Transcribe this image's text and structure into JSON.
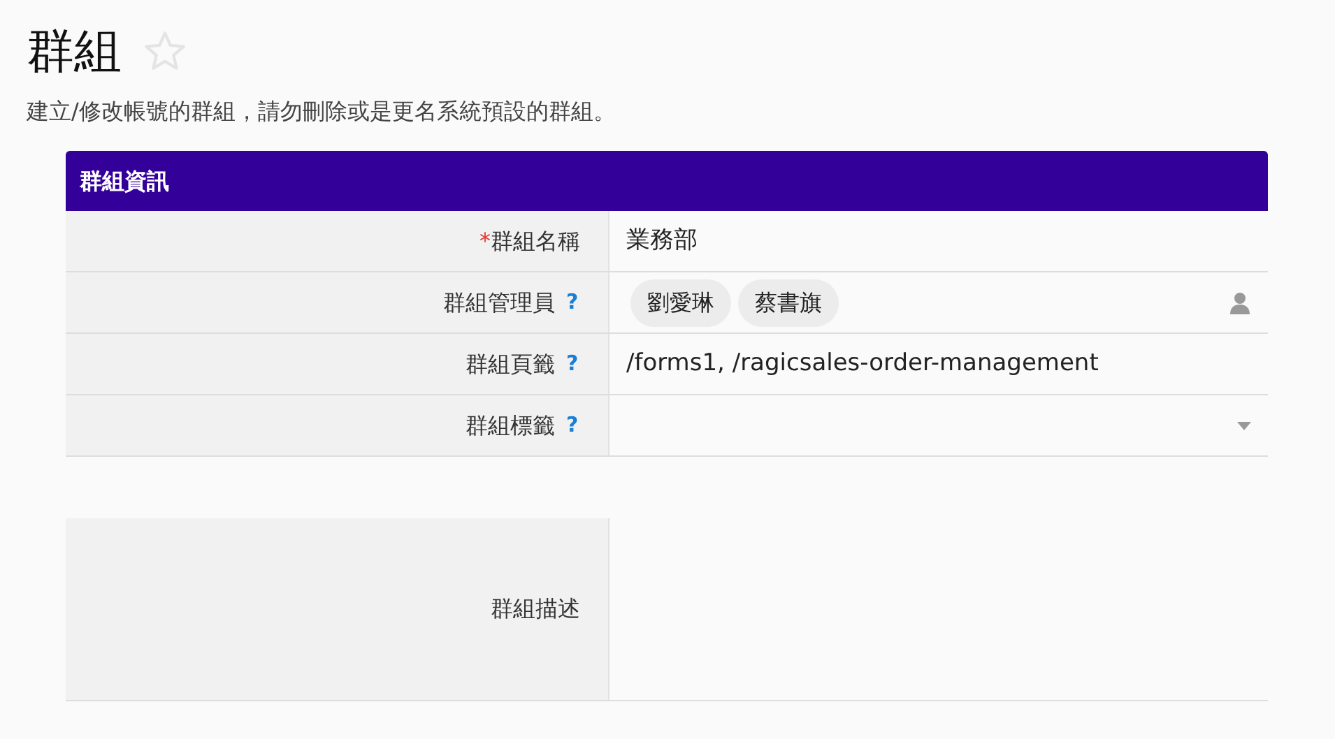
{
  "page": {
    "title": "群組",
    "starred": false,
    "subtitle": "建立/修改帳號的群組，請勿刪除或是更名系統預設的群組。"
  },
  "section": {
    "title": "群組資訊"
  },
  "fields": [
    {
      "kind": "text",
      "label": "群組名稱",
      "required": true,
      "value": "業務部"
    },
    {
      "kind": "people",
      "label": "群組管理員",
      "required": false,
      "help": "?",
      "tags": [
        "劉愛琳",
        "蔡書旗"
      ]
    },
    {
      "kind": "text",
      "label": "群組頁籤",
      "required": false,
      "help": "?",
      "value": "/forms1, /ragicsales-order-management"
    },
    {
      "kind": "select",
      "label": "群組標籤",
      "required": false,
      "help": "?"
    }
  ],
  "required_mark": "*",
  "description": {
    "label": "群組描述"
  }
}
